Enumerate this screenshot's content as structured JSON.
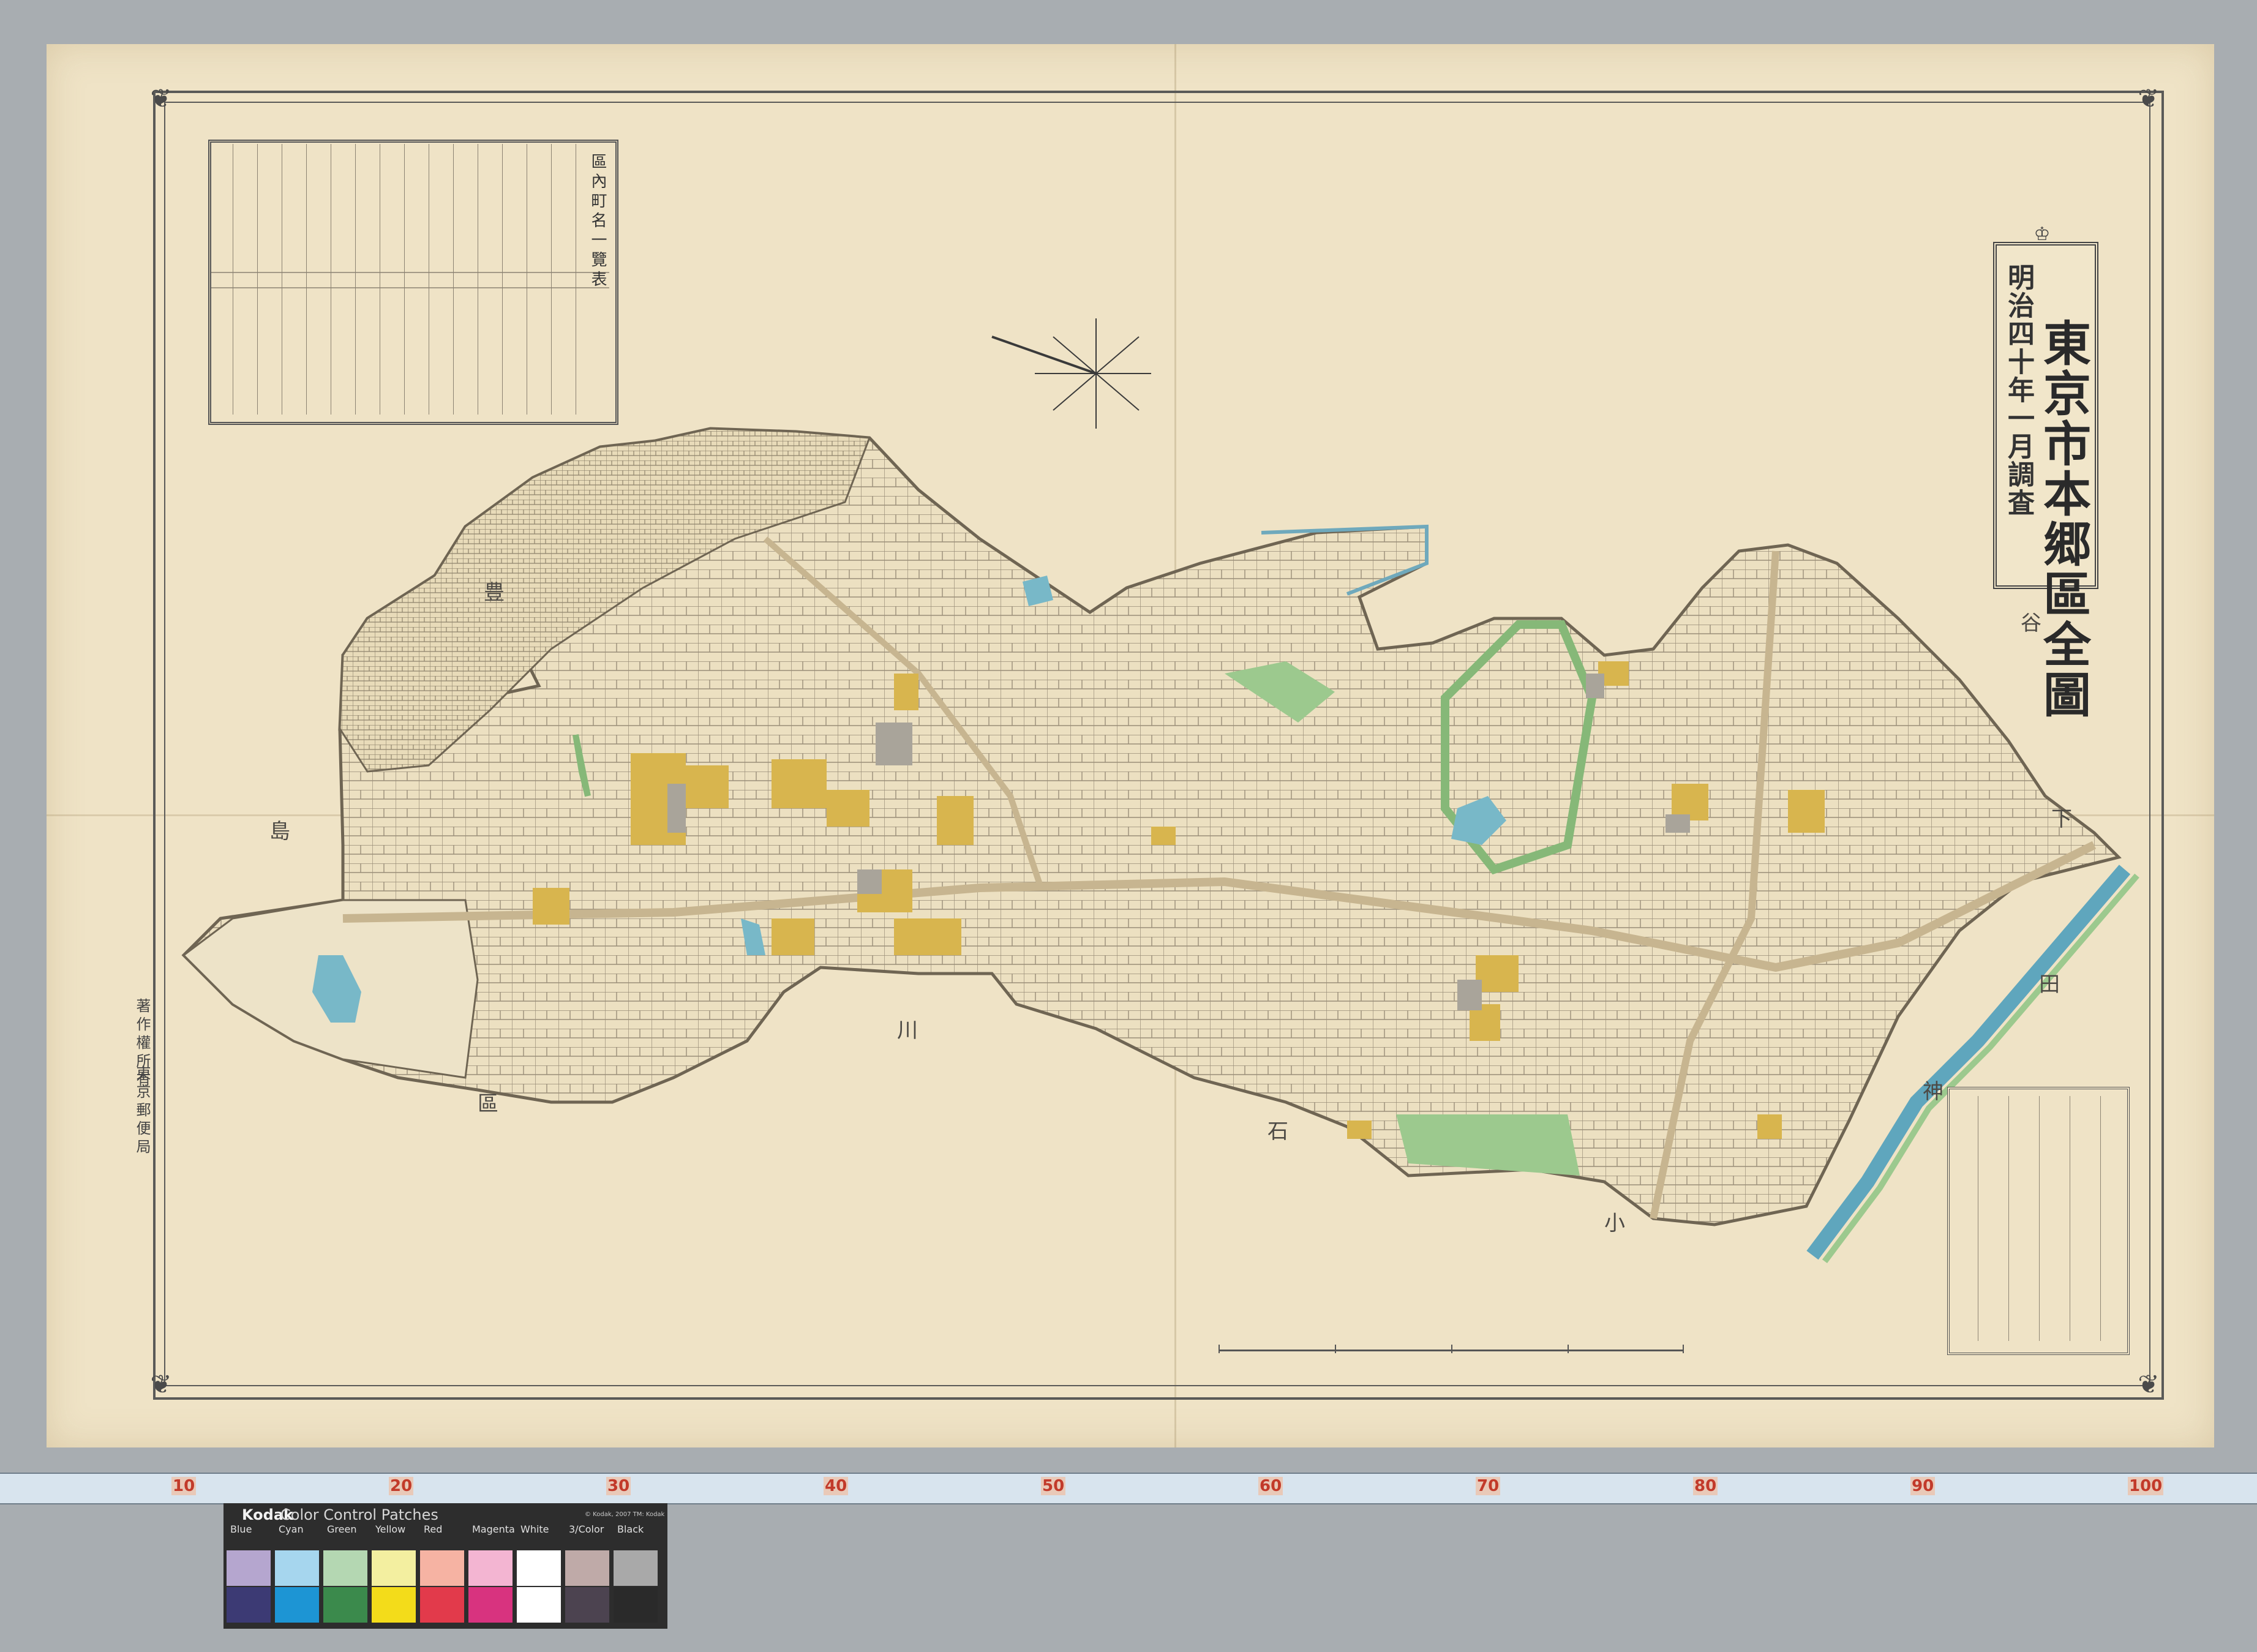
{
  "map": {
    "title_small": "明治四十年一月調査",
    "title_main": "東京市本郷區全圖",
    "town_table_title": "區內町名一覽表",
    "publisher_copyright": "著作權所有",
    "publisher_owner": "東京郵便局",
    "district_labels": [
      "小",
      "石",
      "川",
      "區",
      "谷",
      "下",
      "田",
      "神",
      "豊",
      "島"
    ]
  },
  "ruler": {
    "labels": [
      "10",
      "20",
      "30",
      "40",
      "50",
      "60",
      "70",
      "80",
      "90",
      "100"
    ]
  },
  "color_card": {
    "brand": "Kodak",
    "title": "Color Control Patches",
    "trademark": "© Kodak, 2007 TM: Kodak",
    "patches": [
      {
        "label": "Blue",
        "light": "#b5a6cf",
        "dark": "#3c3a74"
      },
      {
        "label": "Cyan",
        "light": "#a6d6ee",
        "dark": "#1d95d4"
      },
      {
        "label": "Green",
        "light": "#b4d7b2",
        "dark": "#3b8a4c"
      },
      {
        "label": "Yellow",
        "light": "#f3efa0",
        "dark": "#f3dc1a"
      },
      {
        "label": "Red",
        "light": "#f6b3a3",
        "dark": "#e23a4b"
      },
      {
        "label": "Magenta",
        "light": "#f3b5d2",
        "dark": "#d8337f"
      },
      {
        "label": "White",
        "light": "#ffffff",
        "dark": "#ffffff"
      },
      {
        "label": "3/Color",
        "light": "#bfaaa8",
        "dark": "#4c4350"
      },
      {
        "label": "Black",
        "light": "#a9a9a9",
        "dark": "#2a2a2a"
      }
    ]
  },
  "colors": {
    "paper": "#efe3c6",
    "map_base": "#e9dcbc",
    "building_yellow": "#d8b54e",
    "park_green": "#9cc98e",
    "water": "#78b8c8",
    "road": "#c7b590"
  }
}
